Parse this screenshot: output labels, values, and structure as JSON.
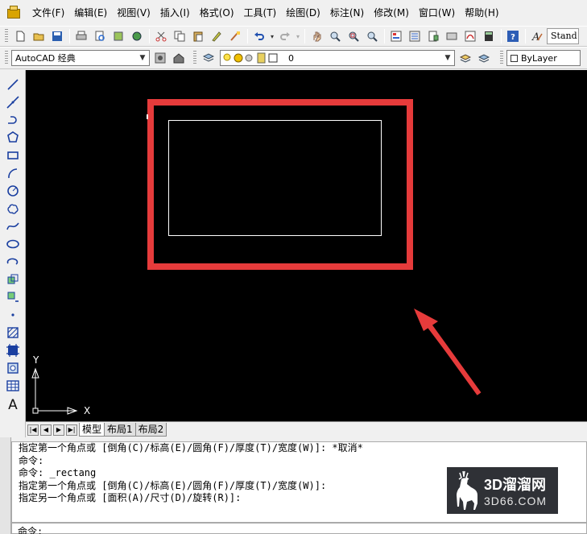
{
  "menubar": {
    "items": [
      "文件(F)",
      "编辑(E)",
      "视图(V)",
      "插入(I)",
      "格式(O)",
      "工具(T)",
      "绘图(D)",
      "标注(N)",
      "修改(M)",
      "窗口(W)",
      "帮助(H)"
    ]
  },
  "toolbar": {
    "text_style": "Stand"
  },
  "workspace": {
    "value": "AutoCAD 经典"
  },
  "layer": {
    "value": "0"
  },
  "color": {
    "value": "ByLayer"
  },
  "canvas": {
    "y_axis_label": "Y",
    "x_axis_label": "X",
    "highlight_color": "#e63b3b",
    "arrow_color": "#e63b3b",
    "rect_color": "#ffffff"
  },
  "tabs": {
    "items": [
      "模型",
      "布局1",
      "布局2"
    ],
    "active": "模型"
  },
  "command": {
    "lines": [
      "指定第一个角点或 [倒角(C)/标高(E)/圆角(F)/厚度(T)/宽度(W)]: *取消*",
      "命令:",
      "命令: _rectang",
      "指定第一个角点或 [倒角(C)/标高(E)/圆角(F)/厚度(T)/宽度(W)]:",
      "指定另一个角点或 [面积(A)/尺寸(D)/旋转(R)]:"
    ],
    "prompt": "命令:"
  },
  "watermark": {
    "title": "3D溜溜网",
    "subtitle": "3D66.COM"
  }
}
